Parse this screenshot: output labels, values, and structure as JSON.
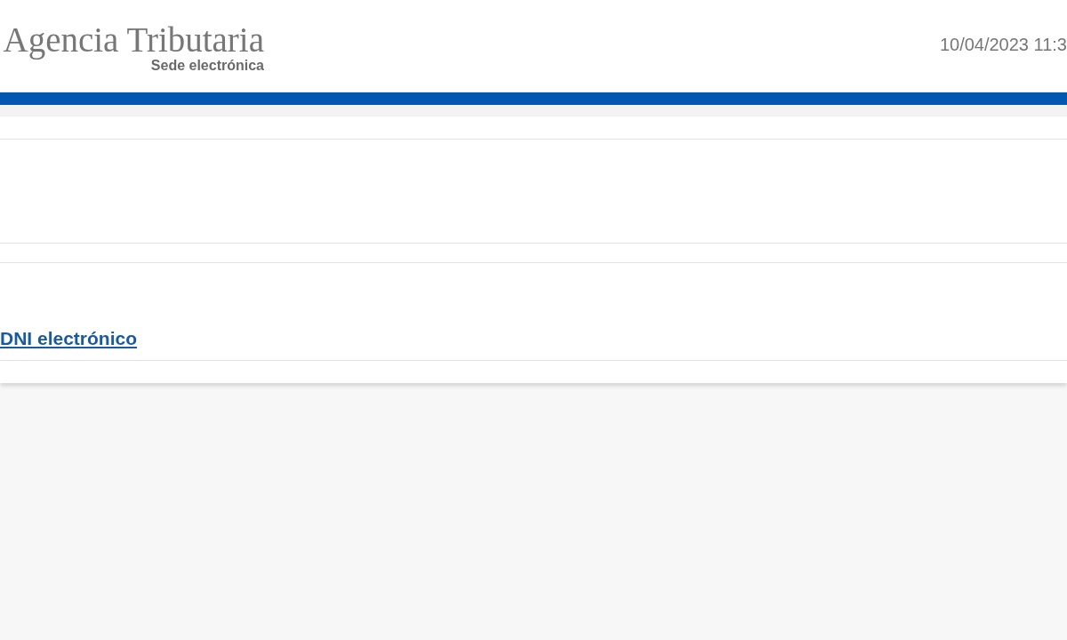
{
  "header": {
    "logo_title": "Agencia Tributaria",
    "logo_subtitle": "Sede electrónica",
    "datetime": "10/04/2023 11:3"
  },
  "panel": {
    "link": "DNI electrónico"
  }
}
